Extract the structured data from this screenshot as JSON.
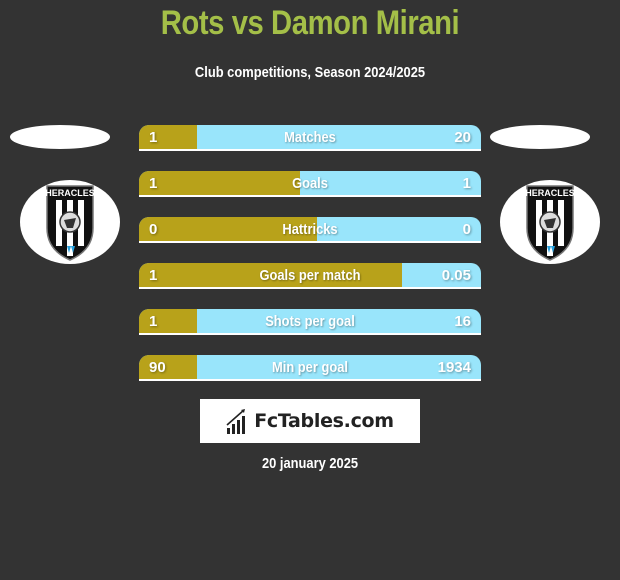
{
  "header": {
    "title": "Rots vs Damon Mirani",
    "subtitle": "Club competitions, Season 2024/2025"
  },
  "teams": {
    "left": {
      "name": "Heracles",
      "crest_text": "HERACLES",
      "icon": "heracles-crest-icon"
    },
    "right": {
      "name": "Heracles",
      "crest_text": "HERACLES",
      "icon": "heracles-crest-icon"
    }
  },
  "colors": {
    "title": "#a4bf48",
    "left_bar": "#b8a21a",
    "right_bar": "#99e5fb",
    "background": "#333333"
  },
  "stats": [
    {
      "label": "Matches",
      "left": "1",
      "right": "20",
      "left_share": 0.17
    },
    {
      "label": "Goals",
      "left": "1",
      "right": "1",
      "left_share": 0.47
    },
    {
      "label": "Hattricks",
      "left": "0",
      "right": "0",
      "left_share": 0.52
    },
    {
      "label": "Goals per match",
      "left": "1",
      "right": "0.05",
      "left_share": 0.77
    },
    {
      "label": "Shots per goal",
      "left": "1",
      "right": "16",
      "left_share": 0.17
    },
    {
      "label": "Min per goal",
      "left": "90",
      "right": "1934",
      "left_share": 0.17
    }
  ],
  "footer": {
    "brand": "FcTables.com",
    "brand_icon": "bar-chart-icon",
    "date": "20 january 2025"
  }
}
